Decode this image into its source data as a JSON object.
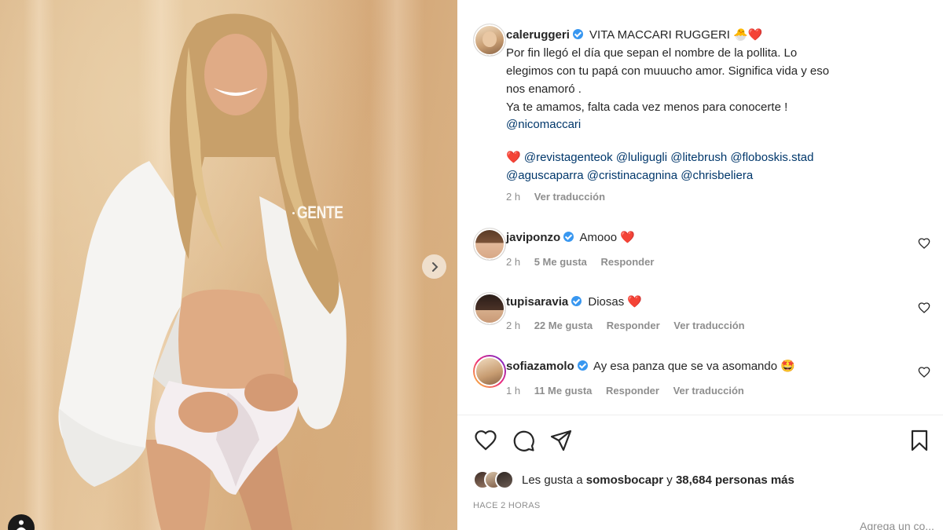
{
  "post_image": {
    "watermark": "GENTE",
    "next_arrow_icon": "chevron-right-icon",
    "tag_icon": "person-tag-icon"
  },
  "caption": {
    "username": "caleruggeri",
    "verified": true,
    "title": "VITA MACCARI RUGGERI",
    "title_emojis": "🐣❤️",
    "lines": [
      "Por fin llegó el día que sepan el nombre de la pollita. Lo",
      "elegimos con tu papá con muuucho amor. Significa vida y eso",
      "nos enamoró .",
      "Ya te amamos, falta cada vez menos para conocerte !"
    ],
    "mention_line": "@nicomaccari",
    "credit_emoji": "❤️",
    "credits_line1": "@revistagenteok @luligugli @litebrush @floboskis.stad",
    "credits_line2": "@aguscaparra @cristinacagnina @chrisbeliera",
    "time": "2 h",
    "translate": "Ver traducción"
  },
  "comments": [
    {
      "username": "javiponzo",
      "verified": true,
      "text": "Amooo",
      "emoji": "❤️",
      "time": "2 h",
      "likes": "5 Me gusta",
      "reply": "Responder",
      "translate": ""
    },
    {
      "username": "tupisaravia",
      "verified": true,
      "text": "Diosas",
      "emoji": "❤️",
      "time": "2 h",
      "likes": "22 Me gusta",
      "reply": "Responder",
      "translate": "Ver traducción"
    },
    {
      "username": "sofiazamolo",
      "verified": true,
      "text": "Ay esa panza que se va asomando",
      "emoji": "🤩",
      "time": "1 h",
      "likes": "11 Me gusta",
      "reply": "Responder",
      "translate": "Ver traducción"
    }
  ],
  "actions": {
    "like_icon": "heart-outline-icon",
    "comment_icon": "comment-bubble-icon",
    "share_icon": "paper-plane-icon",
    "save_icon": "bookmark-icon"
  },
  "likes": {
    "prefix": "Les gusta a ",
    "user": "somosbocapr",
    "suffix": " y ",
    "count": "38,684 personas más"
  },
  "timestamp": "HACE 2 HORAS",
  "add_comment_placeholder": "Agrega un co..."
}
